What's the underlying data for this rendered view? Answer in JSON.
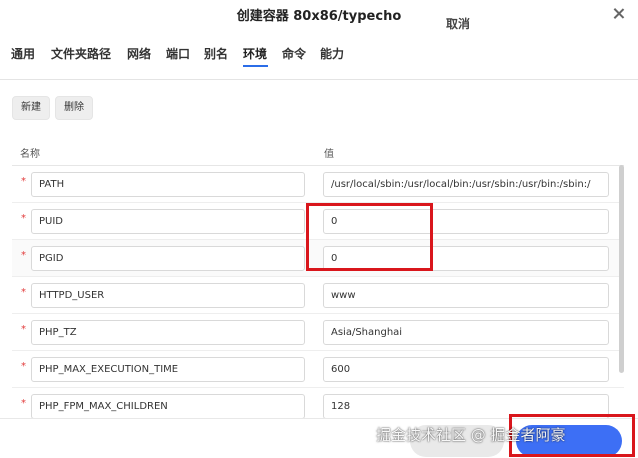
{
  "dialog": {
    "title": "创建容器 80x86/typecho"
  },
  "tabs": [
    {
      "label": "通用"
    },
    {
      "label": "文件夹路径"
    },
    {
      "label": "网络"
    },
    {
      "label": "端口"
    },
    {
      "label": "别名"
    },
    {
      "label": "环境",
      "active": true
    },
    {
      "label": "命令"
    },
    {
      "label": "能力"
    }
  ],
  "actions": {
    "new_label": "新建",
    "delete_label": "删除"
  },
  "table": {
    "columns": {
      "name": "名称",
      "value": "值"
    },
    "required_mark": "*",
    "rows": [
      {
        "name": "PATH",
        "value": "/usr/local/sbin:/usr/local/bin:/usr/sbin:/usr/bin:/sbin:/"
      },
      {
        "name": "PUID",
        "value": "0"
      },
      {
        "name": "PGID",
        "value": "0"
      },
      {
        "name": "HTTPD_USER",
        "value": "www"
      },
      {
        "name": "PHP_TZ",
        "value": "Asia/Shanghai"
      },
      {
        "name": "PHP_MAX_EXECUTION_TIME",
        "value": "600"
      },
      {
        "name": "PHP_FPM_MAX_CHILDREN",
        "value": "128"
      }
    ]
  },
  "footer": {
    "cancel_label": "取消",
    "submit_label": "应用"
  },
  "watermark": {
    "text": "掘金技术社区 @ 掘金者阿豪"
  },
  "colors": {
    "accent": "#2b6de8",
    "submit_button": "#3d6ff5",
    "required": "#e23b3b",
    "highlight_box": "#d9161c"
  }
}
